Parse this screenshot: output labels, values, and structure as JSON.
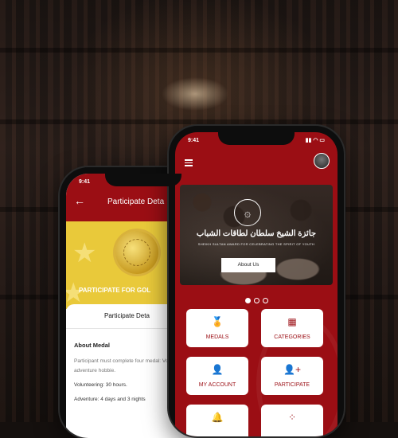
{
  "back_phone": {
    "time": "9:41",
    "title": "Participate Deta",
    "medal_caption": "PARTICIPATE FOR GOL",
    "tab_label": "Participate Deta",
    "about_heading": "About Medal",
    "description": "Participant must complete four medal: Volunteering, adventure hobbie.",
    "volunteering": "Volunteering: 30 hours.",
    "adventure": "Adventure: 4 days and 3 nights"
  },
  "front_phone": {
    "time": "9:41",
    "banner_arabic": "جائزة الشيخ سلطان لطاقات الشباب",
    "banner_english": "SHEIKH SULTAN AWARD FOR CELEBRATING THE SPIRIT OF YOUTH",
    "about_button": "About Us",
    "cards": [
      {
        "label": "MEDALS",
        "icon": "medal-icon"
      },
      {
        "label": "CATEGORIES",
        "icon": "categories-icon"
      },
      {
        "label": "MY ACCOUNT",
        "icon": "user-icon"
      },
      {
        "label": "PARTICIPATE",
        "icon": "add-user-icon"
      }
    ],
    "accent": "#9b0e14"
  }
}
